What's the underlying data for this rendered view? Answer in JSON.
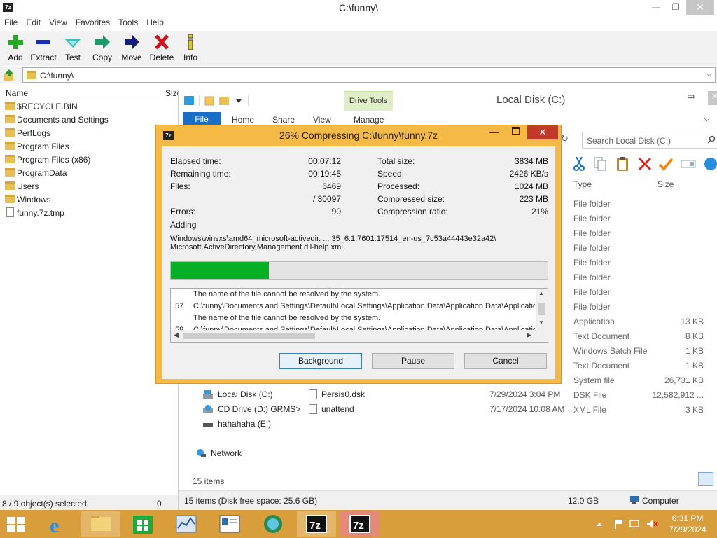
{
  "fm": {
    "window_title": "C:\\funny\\",
    "app_icon": "7z",
    "window_controls": {
      "minimize": "—",
      "maximize": "❐",
      "close": "✕"
    },
    "menu": [
      "File",
      "Edit",
      "View",
      "Favorites",
      "Tools",
      "Help"
    ],
    "toolbar": {
      "add": "Add",
      "extract": "Extract",
      "test": "Test",
      "copy": "Copy",
      "move": "Move",
      "delete": "Delete",
      "info": "Info"
    },
    "address": "C:\\funny\\",
    "columns": {
      "name": "Name",
      "size": "Size"
    },
    "items": [
      {
        "name": "$RECYCLE.BIN",
        "type": "folder"
      },
      {
        "name": "Documents and Settings",
        "type": "folder"
      },
      {
        "name": "PerfLogs",
        "type": "folder"
      },
      {
        "name": "Program Files",
        "type": "folder"
      },
      {
        "name": "Program Files (x86)",
        "type": "folder"
      },
      {
        "name": "ProgramData",
        "type": "folder"
      },
      {
        "name": "Users",
        "type": "folder"
      },
      {
        "name": "Windows",
        "type": "folder"
      },
      {
        "name": "funny.7z.tmp",
        "type": "file"
      }
    ],
    "status_left": "8 / 9 object(s) selected",
    "status_right": "0"
  },
  "explorer": {
    "window_title": "Local Disk (C:)",
    "drive_tools": "Drive Tools",
    "tabs": {
      "file": "File",
      "home": "Home",
      "share": "Share",
      "view": "View",
      "manage": "Manage"
    },
    "search_placeholder": "Search Local Disk (C:)",
    "columns": {
      "type": "Type",
      "size": "Size"
    },
    "rows": [
      {
        "type": "File folder",
        "size": ""
      },
      {
        "type": "File folder",
        "size": ""
      },
      {
        "type": "File folder",
        "size": ""
      },
      {
        "type": "File folder",
        "size": ""
      },
      {
        "type": "File folder",
        "size": ""
      },
      {
        "type": "File folder",
        "size": ""
      },
      {
        "type": "File folder",
        "size": ""
      },
      {
        "type": "File folder",
        "size": ""
      },
      {
        "type": "Application",
        "size": "13 KB"
      },
      {
        "type": "Text Document",
        "size": "8 KB"
      },
      {
        "type": "Windows Batch File",
        "size": "1 KB"
      },
      {
        "type": "Text Document",
        "size": "1 KB"
      },
      {
        "type": "System file",
        "size": "26,731 KB"
      },
      {
        "type": "DSK File",
        "size": "12,582,912 ..."
      },
      {
        "type": "XML File",
        "size": "3 KB"
      }
    ],
    "nav": [
      {
        "label": "Local Disk (C:)",
        "icon": "drive-icon"
      },
      {
        "label": "CD Drive (D:) GRMS>",
        "icon": "cd-drive-icon"
      },
      {
        "label": "hahahaha (E:)",
        "icon": "usb-drive-icon"
      },
      {
        "label": "Network",
        "icon": "network-icon"
      }
    ],
    "files": [
      {
        "name": "Persis0.dsk",
        "date": "7/29/2024 3:04 PM"
      },
      {
        "name": "unattend",
        "date": "7/17/2024 10:08 AM"
      }
    ],
    "items_count": "15 items",
    "status_left": "15 items (Disk free space: 25.6 GB)",
    "status_size": "12.0 GB",
    "status_location": "Computer"
  },
  "dialog": {
    "title": "26% Compressing C:\\funny\\funny.7z",
    "app_icon": "7z",
    "stats_left": {
      "elapsed_label": "Elapsed time:",
      "elapsed": "00:07:12",
      "remaining_label": "Remaining time:",
      "remaining": "00:19:45",
      "files_label": "Files:",
      "files": "6469",
      "files_total": "/ 30097",
      "errors_label": "Errors:",
      "errors": "90",
      "adding_label": "Adding"
    },
    "stats_right": {
      "total_label": "Total size:",
      "total": "3834 MB",
      "speed_label": "Speed:",
      "speed": "2426 KB/s",
      "processed_label": "Processed:",
      "processed": "1024 MB",
      "compressed_label": "Compressed size:",
      "compressed": "223 MB",
      "ratio_label": "Compression ratio:",
      "ratio": "21%"
    },
    "current_file_line1": "Windows\\winsxs\\amd64_microsoft-activedir. ... 35_6.1.7601.17514_en-us_7c53a44443e32a42\\",
    "current_file_line2": "Microsoft.ActiveDirectory.Management.dll-help.xml",
    "progress_fraction": 0.26,
    "progress_color": "#06b025",
    "log": [
      {
        "num": "",
        "text": "The name of the file cannot be resolved by the system."
      },
      {
        "num": "57",
        "text": "C:\\funny\\Documents and Settings\\Default\\Local Settings\\Application Data\\Application Data\\Applicatio"
      },
      {
        "num": "",
        "text": "The name of the file cannot be resolved by the system."
      },
      {
        "num": "58",
        "text": "C:\\funny\\Documents and Settings\\Default\\Local Settings\\Application Data\\Application Data\\Applicatio"
      }
    ],
    "buttons": {
      "background": "Background",
      "pause": "Pause",
      "cancel": "Cancel"
    }
  },
  "taskbar": {
    "time": "6:31 PM",
    "date": "7/29/2024",
    "apps": [
      "internet-explorer-icon",
      "file-explorer-icon",
      "store-icon",
      "performance-monitor-icon",
      "system-information-icon",
      "update-globe-icon",
      "7zip-icon",
      "7zip-active-icon"
    ]
  }
}
